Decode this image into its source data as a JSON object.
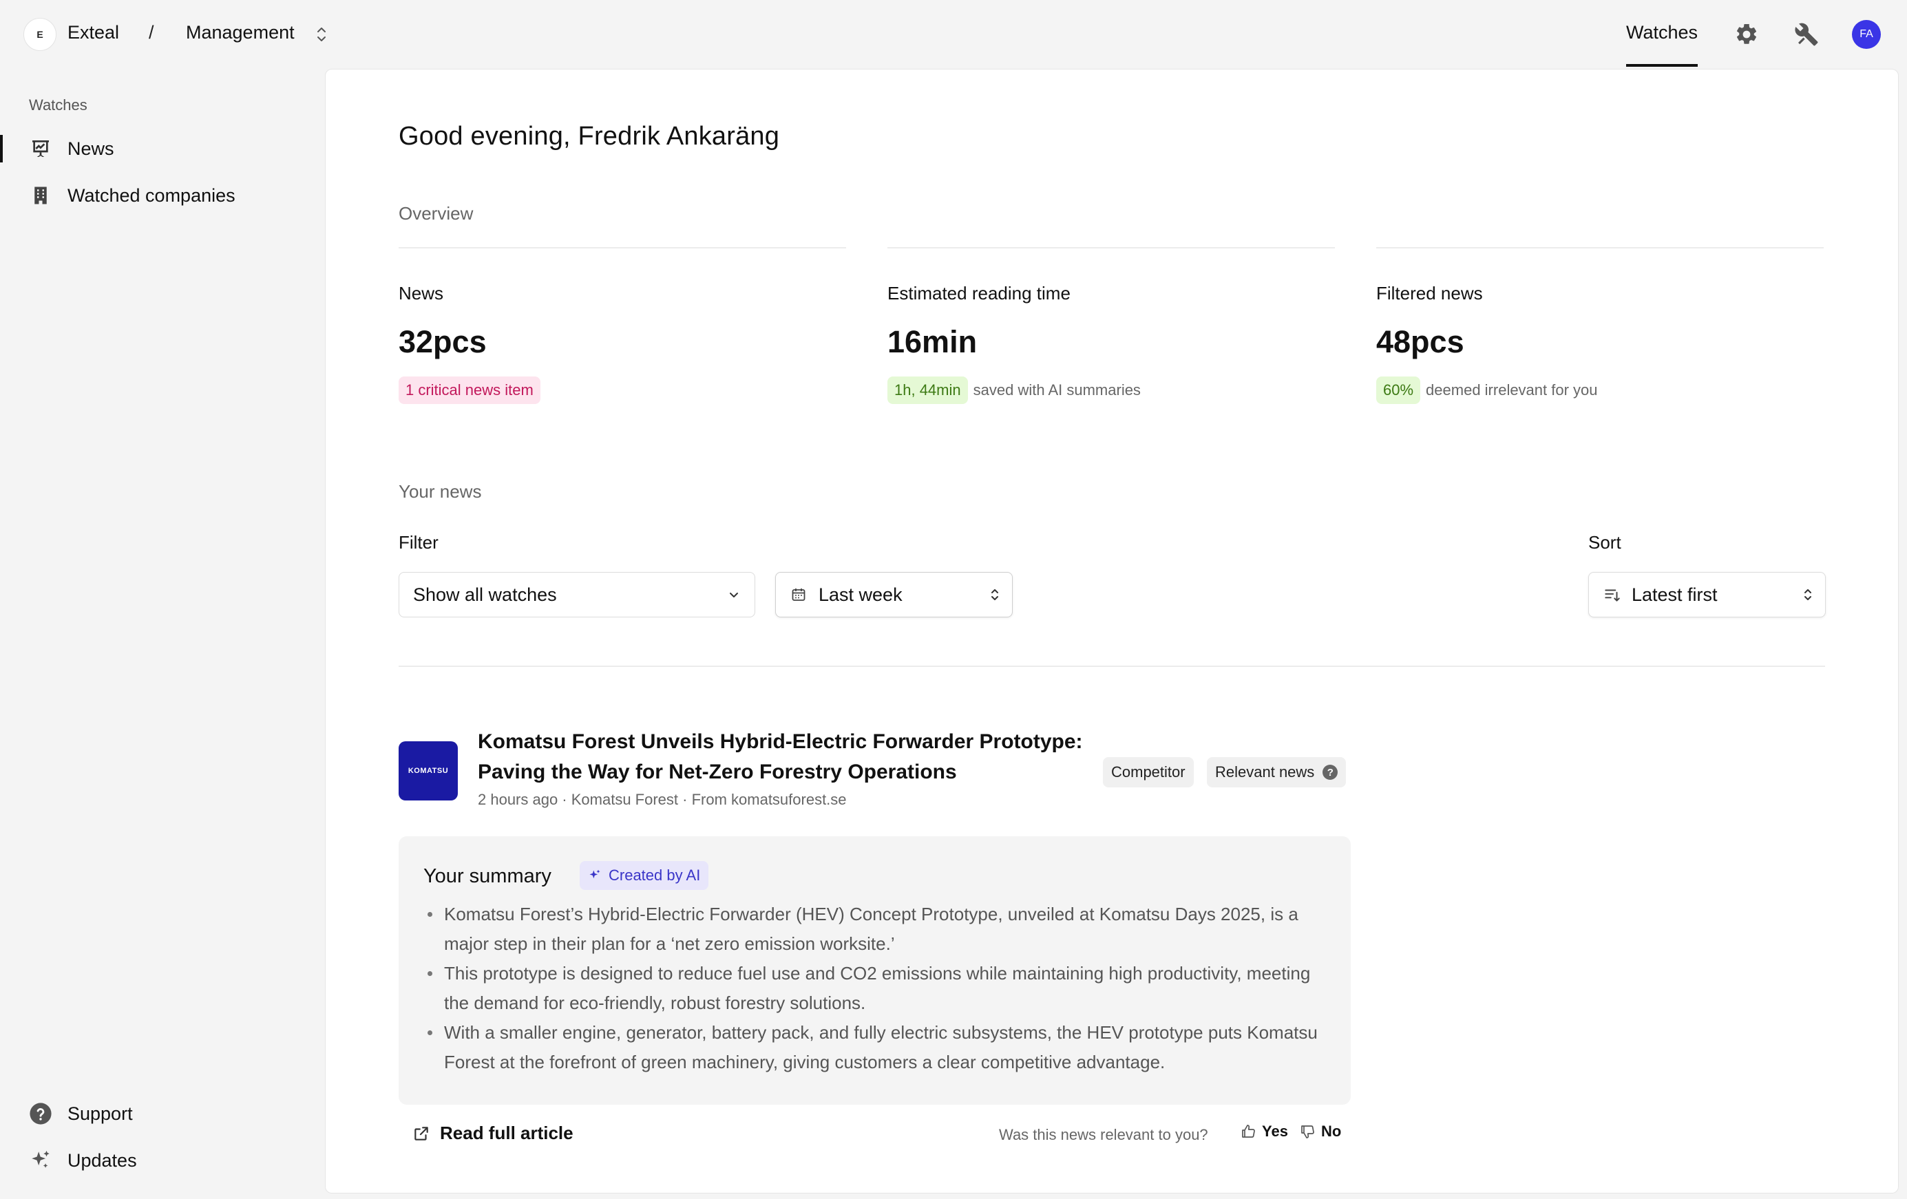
{
  "header": {
    "org_initial": "E",
    "org_name": "Exteal",
    "separator": "/",
    "workspace": "Management",
    "nav_tab": "Watches",
    "avatar_initials": "FA"
  },
  "sidebar": {
    "section": "Watches",
    "items": [
      {
        "label": "News",
        "icon": "news-chart-icon",
        "active": true
      },
      {
        "label": "Watched companies",
        "icon": "building-icon",
        "active": false
      }
    ],
    "bottom_items": [
      {
        "label": "Support",
        "icon": "help-circle-icon"
      },
      {
        "label": "Updates",
        "icon": "sparkles-icon"
      }
    ]
  },
  "main": {
    "greeting": "Good evening, Fredrik Ankaräng",
    "overview_label": "Overview",
    "stats": [
      {
        "title": "News",
        "value": "32pcs",
        "badge": "1 critical news item",
        "badge_color": "#c2185b",
        "note": ""
      },
      {
        "title": "Estimated reading time",
        "value": "16min",
        "badge": "1h, 44min",
        "badge_color": "#3d7a14",
        "note": "saved with AI summaries"
      },
      {
        "title": "Filtered news",
        "value": "48pcs",
        "badge": "60%",
        "badge_color": "#3d7a14",
        "note": "deemed irrelevant for you"
      }
    ],
    "your_news_label": "Your news",
    "filter_label": "Filter",
    "sort_label": "Sort",
    "watch_filter": "Show all watches",
    "period_filter": "Last week",
    "sort_value": "Latest first"
  },
  "article": {
    "logo_text": "KOMATSU",
    "title": "Komatsu Forest Unveils Hybrid-Electric Forwarder Prototype: Paving the Way for Net-Zero Forestry Operations",
    "meta": "2 hours ago · Komatsu Forest · From komatsuforest.se",
    "tags": [
      "Competitor",
      "Relevant news"
    ],
    "summary_title": "Your summary",
    "ai_badge": "Created by AI",
    "summary": [
      "Komatsu Forest’s Hybrid-Electric Forwarder (HEV) Concept Prototype, unveiled at Komatsu Days 2025, is a major step in their plan for a ‘net zero emission worksite.’",
      "This prototype is designed to reduce fuel use and CO2 emissions while maintaining high productivity, meeting the demand for eco-friendly, robust forestry solutions.",
      "With a smaller engine, generator, battery pack, and fully electric subsystems, the HEV prototype puts Komatsu Forest at the forefront of green machinery, giving customers a clear competitive advantage."
    ],
    "read_link": "Read full article",
    "feedback_question": "Was this news relevant to you?",
    "yes": "Yes",
    "no": "No"
  },
  "colors": {
    "accent": "#3a35e6",
    "komatsu_blue": "#1a1aa3",
    "critical": "#c2185b",
    "positive": "#3d7a14"
  }
}
